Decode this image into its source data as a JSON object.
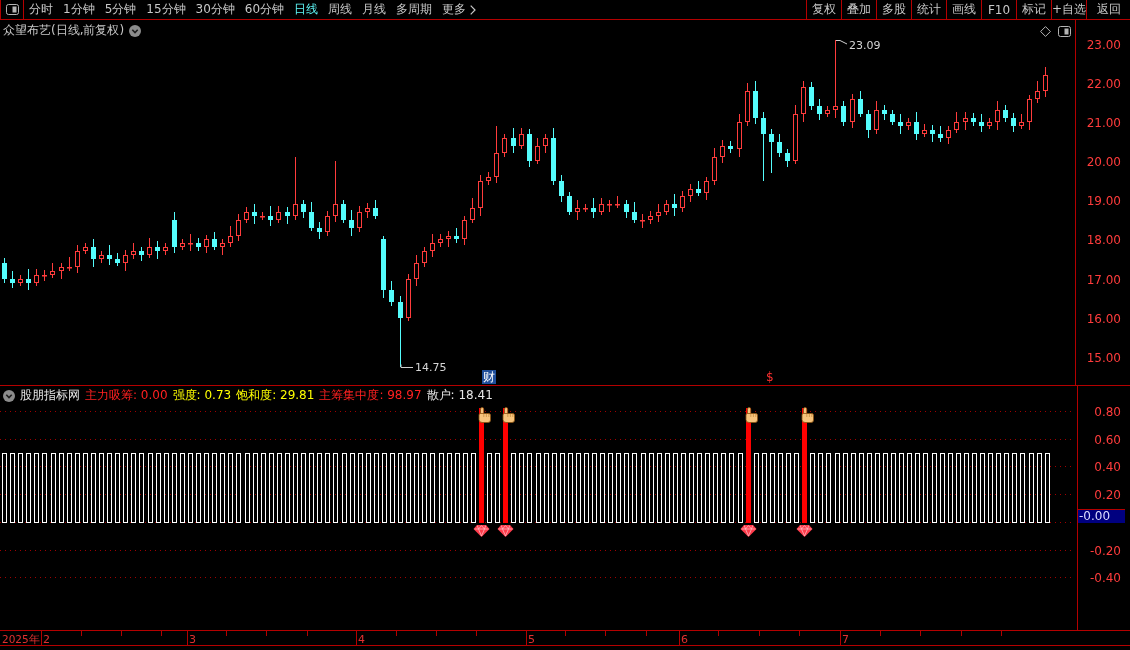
{
  "toolbar": {
    "periods": [
      {
        "label": "分时",
        "selected": false
      },
      {
        "label": "1分钟",
        "selected": false
      },
      {
        "label": "5分钟",
        "selected": false
      },
      {
        "label": "15分钟",
        "selected": false
      },
      {
        "label": "30分钟",
        "selected": false
      },
      {
        "label": "60分钟",
        "selected": false
      },
      {
        "label": "日线",
        "selected": true
      },
      {
        "label": "周线",
        "selected": false
      },
      {
        "label": "月线",
        "selected": false
      },
      {
        "label": "多周期",
        "selected": false
      }
    ],
    "more": {
      "label": "更多"
    },
    "buttons": [
      "复权",
      "叠加",
      "多股",
      "统计",
      "画线",
      "F10",
      "标记",
      "+自选",
      "返回"
    ]
  },
  "price_chart": {
    "title": "众望布艺(日线,前复权)",
    "high_label": "23.09",
    "low_label": "14.75",
    "event_marks": [
      {
        "kind": "finance",
        "text": "财"
      },
      {
        "kind": "dollar",
        "text": "$"
      }
    ],
    "chart_data": {
      "type": "candlestick",
      "ylim": [
        14.28,
        23.61
      ],
      "yticks": [
        {
          "value": 23,
          "label": "23.00"
        },
        {
          "value": 22,
          "label": "22.00"
        },
        {
          "value": 21,
          "label": "21.00"
        },
        {
          "value": 20,
          "label": "20.00"
        },
        {
          "value": 19,
          "label": "19.00"
        },
        {
          "value": 18,
          "label": "18.00"
        },
        {
          "value": 17,
          "label": "17.00"
        },
        {
          "value": 16,
          "label": "16.00"
        },
        {
          "value": 15,
          "label": "15.00"
        }
      ],
      "categories": [
        null,
        null,
        null,
        null,
        null,
        null,
        null,
        null,
        null,
        null,
        null,
        null,
        null,
        null,
        null,
        null,
        null,
        null,
        null,
        null,
        null,
        null,
        null,
        null,
        null,
        null,
        null,
        null,
        null,
        null,
        null,
        null,
        null,
        null,
        null,
        null,
        null,
        null,
        null,
        null,
        null,
        null,
        null,
        null,
        null,
        null,
        null,
        null,
        null,
        null,
        null,
        null,
        null,
        null,
        null,
        null,
        null,
        null,
        null,
        null,
        null,
        null,
        null,
        null,
        null,
        null,
        null,
        null,
        null,
        null,
        null,
        null,
        null,
        null,
        null,
        null,
        null,
        null,
        null,
        null,
        null,
        null,
        null,
        null,
        null,
        null,
        null,
        null,
        null,
        null,
        null,
        null,
        null,
        null,
        null,
        null,
        null,
        null,
        null,
        null,
        null,
        null,
        null,
        null,
        null,
        null,
        null,
        null,
        null,
        null,
        null,
        null,
        null,
        null,
        null,
        null,
        null,
        null,
        null,
        null,
        null,
        null,
        null,
        null,
        null,
        null,
        null,
        null,
        null,
        null,
        null,
        null,
        null,
        null,
        null,
        null,
        null,
        null,
        null,
        null
      ],
      "ohlc": [
        [
          17.4,
          17.52,
          16.9,
          17.0
        ],
        [
          17.0,
          17.2,
          16.75,
          16.9
        ],
        [
          16.9,
          17.1,
          16.82,
          17.0
        ],
        [
          17.0,
          17.25,
          16.7,
          16.9
        ],
        [
          16.9,
          17.25,
          16.8,
          17.1
        ],
        [
          17.1,
          17.22,
          16.95,
          17.1
        ],
        [
          17.1,
          17.4,
          17.02,
          17.2
        ],
        [
          17.2,
          17.4,
          17.0,
          17.3
        ],
        [
          17.3,
          17.55,
          17.2,
          17.3
        ],
        [
          17.3,
          17.85,
          17.15,
          17.7
        ],
        [
          17.7,
          17.92,
          17.62,
          17.8
        ],
        [
          17.8,
          18.0,
          17.3,
          17.5
        ],
        [
          17.5,
          17.7,
          17.4,
          17.6
        ],
        [
          17.6,
          17.85,
          17.35,
          17.5
        ],
        [
          17.5,
          17.65,
          17.32,
          17.4
        ],
        [
          17.4,
          17.72,
          17.2,
          17.6
        ],
        [
          17.6,
          17.9,
          17.5,
          17.7
        ],
        [
          17.7,
          17.8,
          17.45,
          17.6
        ],
        [
          17.6,
          18.05,
          17.52,
          17.8
        ],
        [
          17.8,
          17.95,
          17.5,
          17.7
        ],
        [
          17.7,
          17.92,
          17.6,
          17.8
        ],
        [
          18.5,
          18.7,
          17.65,
          17.8
        ],
        [
          17.8,
          18.0,
          17.72,
          17.9
        ],
        [
          17.9,
          18.15,
          17.7,
          17.9
        ],
        [
          17.9,
          18.05,
          17.7,
          17.8
        ],
        [
          17.8,
          18.12,
          17.65,
          18.0
        ],
        [
          18.0,
          18.2,
          17.72,
          17.8
        ],
        [
          17.8,
          18.0,
          17.6,
          17.9
        ],
        [
          17.9,
          18.35,
          17.8,
          18.1
        ],
        [
          18.1,
          18.65,
          17.95,
          18.5
        ],
        [
          18.5,
          18.82,
          18.42,
          18.7
        ],
        [
          18.7,
          18.9,
          18.4,
          18.6
        ],
        [
          18.6,
          18.7,
          18.5,
          18.6
        ],
        [
          18.6,
          18.85,
          18.35,
          18.5
        ],
        [
          18.5,
          18.85,
          18.42,
          18.7
        ],
        [
          18.7,
          18.82,
          18.4,
          18.6
        ],
        [
          18.6,
          20.1,
          18.5,
          18.9
        ],
        [
          18.9,
          19.0,
          18.55,
          18.7
        ],
        [
          18.7,
          18.95,
          18.22,
          18.3
        ],
        [
          18.3,
          18.45,
          18.0,
          18.2
        ],
        [
          18.2,
          18.72,
          18.1,
          18.6
        ],
        [
          18.6,
          20.0,
          18.45,
          18.9
        ],
        [
          18.9,
          19.0,
          18.42,
          18.5
        ],
        [
          18.5,
          18.75,
          18.1,
          18.3
        ],
        [
          18.3,
          18.85,
          18.2,
          18.7
        ],
        [
          18.7,
          18.92,
          18.55,
          18.8
        ],
        [
          18.8,
          19.0,
          18.52,
          18.6
        ],
        [
          18.0,
          18.1,
          16.5,
          16.7
        ],
        [
          16.7,
          16.95,
          16.3,
          16.4
        ],
        [
          16.4,
          16.55,
          14.75,
          16.0
        ],
        [
          16.0,
          17.12,
          15.92,
          17.0
        ],
        [
          17.0,
          17.6,
          16.8,
          17.4
        ],
        [
          17.4,
          17.8,
          17.3,
          17.7
        ],
        [
          17.7,
          18.15,
          17.55,
          17.9
        ],
        [
          17.9,
          18.15,
          17.82,
          18.0
        ],
        [
          18.0,
          18.22,
          17.8,
          18.1
        ],
        [
          18.1,
          18.3,
          17.9,
          18.0
        ],
        [
          18.0,
          18.6,
          17.85,
          18.5
        ],
        [
          18.5,
          19.05,
          18.42,
          18.8
        ],
        [
          18.8,
          19.65,
          18.6,
          19.5
        ],
        [
          19.5,
          19.72,
          19.4,
          19.6
        ],
        [
          19.6,
          20.9,
          19.45,
          20.2
        ],
        [
          20.2,
          20.7,
          20.12,
          20.6
        ],
        [
          20.6,
          20.85,
          20.2,
          20.4
        ],
        [
          20.4,
          20.85,
          20.3,
          20.7
        ],
        [
          20.7,
          20.82,
          19.85,
          20.0
        ],
        [
          20.0,
          20.6,
          19.92,
          20.4
        ],
        [
          20.4,
          20.7,
          20.2,
          20.6
        ],
        [
          20.6,
          20.85,
          19.4,
          19.5
        ],
        [
          19.5,
          19.65,
          18.95,
          19.1
        ],
        [
          19.1,
          19.22,
          18.62,
          18.7
        ],
        [
          18.7,
          19.0,
          18.5,
          18.8
        ],
        [
          18.8,
          18.9,
          18.7,
          18.8
        ],
        [
          18.8,
          19.05,
          18.55,
          18.7
        ],
        [
          18.7,
          19.05,
          18.62,
          18.9
        ],
        [
          18.9,
          19.02,
          18.7,
          18.9
        ],
        [
          18.9,
          19.1,
          18.8,
          18.9
        ],
        [
          18.9,
          19.0,
          18.55,
          18.7
        ],
        [
          18.7,
          18.95,
          18.42,
          18.5
        ],
        [
          18.5,
          18.65,
          18.3,
          18.5
        ],
        [
          18.5,
          18.72,
          18.4,
          18.6
        ],
        [
          18.6,
          18.9,
          18.45,
          18.7
        ],
        [
          18.7,
          19.0,
          18.62,
          18.9
        ],
        [
          18.9,
          19.15,
          18.6,
          18.8
        ],
        [
          18.8,
          19.25,
          18.7,
          19.1
        ],
        [
          19.1,
          19.42,
          18.95,
          19.3
        ],
        [
          19.3,
          19.5,
          19.12,
          19.2
        ],
        [
          19.2,
          19.6,
          19.0,
          19.5
        ],
        [
          19.5,
          20.35,
          19.4,
          20.1
        ],
        [
          20.1,
          20.55,
          19.95,
          20.4
        ],
        [
          20.4,
          20.52,
          20.22,
          20.3
        ],
        [
          20.3,
          21.2,
          20.1,
          21.0
        ],
        [
          21.0,
          22.0,
          20.9,
          21.8
        ],
        [
          21.8,
          22.05,
          20.95,
          21.1
        ],
        [
          21.1,
          21.25,
          19.5,
          20.7
        ],
        [
          20.7,
          20.82,
          19.7,
          20.5
        ],
        [
          20.5,
          20.7,
          20.1,
          20.2
        ],
        [
          20.2,
          20.3,
          19.85,
          20.0
        ],
        [
          20.0,
          21.45,
          19.92,
          21.2
        ],
        [
          21.2,
          22.05,
          21.0,
          21.9
        ],
        [
          21.9,
          22.02,
          21.3,
          21.4
        ],
        [
          21.4,
          21.6,
          21.05,
          21.2
        ],
        [
          21.2,
          21.4,
          21.12,
          21.3
        ],
        [
          21.3,
          23.09,
          21.1,
          21.4
        ],
        [
          21.4,
          21.55,
          20.9,
          21.0
        ],
        [
          21.0,
          21.72,
          20.85,
          21.6
        ],
        [
          21.6,
          21.8,
          21.12,
          21.2
        ],
        [
          21.2,
          21.3,
          20.6,
          20.8
        ],
        [
          20.8,
          21.55,
          20.7,
          21.3
        ],
        [
          21.3,
          21.45,
          21.05,
          21.2
        ],
        [
          21.2,
          21.32,
          20.92,
          21.0
        ],
        [
          21.0,
          21.2,
          20.7,
          20.9
        ],
        [
          20.9,
          21.1,
          20.8,
          21.0
        ],
        [
          21.0,
          21.25,
          20.55,
          20.7
        ],
        [
          20.7,
          20.95,
          20.62,
          20.8
        ],
        [
          20.8,
          20.92,
          20.5,
          20.7
        ],
        [
          20.7,
          20.9,
          20.5,
          20.6
        ],
        [
          20.6,
          20.9,
          20.45,
          20.8
        ],
        [
          20.8,
          21.25,
          20.72,
          21.0
        ],
        [
          21.0,
          21.25,
          20.8,
          21.1
        ],
        [
          21.1,
          21.22,
          20.9,
          21.0
        ],
        [
          21.0,
          21.2,
          20.75,
          20.9
        ],
        [
          20.9,
          21.1,
          20.82,
          21.0
        ],
        [
          21.0,
          21.55,
          20.8,
          21.3
        ],
        [
          21.3,
          21.45,
          21.0,
          21.1
        ],
        [
          21.1,
          21.22,
          20.75,
          20.9
        ],
        [
          20.9,
          21.2,
          20.82,
          21.0
        ],
        [
          21.0,
          21.7,
          20.8,
          21.6
        ],
        [
          21.6,
          22.05,
          21.5,
          21.8
        ],
        [
          21.8,
          22.4,
          21.65,
          22.2
        ],
        null,
        null,
        null,
        null,
        null,
        null,
        null,
        null,
        null,
        null
      ]
    }
  },
  "indicator": {
    "name": "股朋指标网",
    "readings": [
      {
        "text": "主力吸筹: 0.00",
        "color": "#ff2020"
      },
      {
        "text": "强度: 0.73",
        "color": "#ffff00"
      },
      {
        "text": "饱和度: 29.81",
        "color": "#ffff00"
      },
      {
        "text": "主筹集中度: 98.97",
        "color": "#ff2020"
      },
      {
        "text": "散户: 18.41",
        "color": "#e6e6e6"
      }
    ],
    "current_value": "-0.00",
    "chart_data": {
      "type": "bar",
      "grid": true,
      "ylim": [
        -0.78,
        0.98
      ],
      "yticks": [
        {
          "value": 0.8,
          "label": "0.80"
        },
        {
          "value": 0.6,
          "label": "0.60"
        },
        {
          "value": 0.4,
          "label": "0.40"
        },
        {
          "value": 0.2,
          "label": "0.20"
        },
        {
          "value": -0.2,
          "label": "-0.20"
        },
        {
          "value": -0.4,
          "label": "-0.40"
        }
      ],
      "series": [
        {
          "color": "#ffffff",
          "values": [
            0.5,
            0.5,
            0.5,
            0.5,
            0.5,
            0.5,
            0.5,
            0.5,
            0.5,
            0.5,
            0.5,
            0.5,
            0.5,
            0.5,
            0.5,
            0.5,
            0.5,
            0.5,
            0.5,
            0.5,
            0.5,
            0.5,
            0.5,
            0.5,
            0.5,
            0.5,
            0.5,
            0.5,
            0.5,
            0.5,
            0.5,
            0.5,
            0.5,
            0.5,
            0.5,
            0.5,
            0.5,
            0.5,
            0.5,
            0.5,
            0.5,
            0.5,
            0.5,
            0.5,
            0.5,
            0.5,
            0.5,
            0.5,
            0.5,
            0.5,
            0.5,
            0.5,
            0.5,
            0.5,
            0.5,
            0.5,
            0.5,
            0.5,
            0.5,
            null,
            0.5,
            0.5,
            null,
            0.5,
            0.5,
            0.5,
            0.5,
            0.5,
            0.5,
            0.5,
            0.5,
            0.5,
            0.5,
            0.5,
            0.5,
            0.5,
            0.5,
            0.5,
            0.5,
            0.5,
            0.5,
            0.5,
            0.5,
            0.5,
            0.5,
            0.5,
            0.5,
            0.5,
            0.5,
            0.5,
            0.5,
            0.5,
            null,
            0.5,
            0.5,
            0.5,
            0.5,
            0.5,
            0.5,
            null,
            0.5,
            0.5,
            0.5,
            0.5,
            0.5,
            0.5,
            0.5,
            0.5,
            0.5,
            0.5,
            0.5,
            0.5,
            0.5,
            0.5,
            0.5,
            0.5,
            0.5,
            0.5,
            0.5,
            0.5,
            0.5,
            0.5,
            0.5,
            0.5,
            0.5,
            0.5,
            0.5,
            0.5,
            0.5,
            0.5,
            null,
            null,
            null
          ]
        },
        {
          "color": "#ff0000",
          "values": [
            null,
            null,
            null,
            null,
            null,
            null,
            null,
            null,
            null,
            null,
            null,
            null,
            null,
            null,
            null,
            null,
            null,
            null,
            null,
            null,
            null,
            null,
            null,
            null,
            null,
            null,
            null,
            null,
            null,
            null,
            null,
            null,
            null,
            null,
            null,
            null,
            null,
            null,
            null,
            null,
            null,
            null,
            null,
            null,
            null,
            null,
            null,
            null,
            null,
            null,
            null,
            null,
            null,
            null,
            null,
            null,
            null,
            null,
            null,
            0.82,
            null,
            null,
            0.82,
            null,
            null,
            null,
            null,
            null,
            null,
            null,
            null,
            null,
            null,
            null,
            null,
            null,
            null,
            null,
            null,
            null,
            null,
            null,
            null,
            null,
            null,
            null,
            null,
            null,
            null,
            null,
            null,
            null,
            0.82,
            null,
            null,
            null,
            null,
            null,
            null,
            0.82,
            null,
            null,
            null,
            null,
            null,
            null,
            null,
            null,
            null,
            null,
            null,
            null,
            null,
            null,
            null,
            null,
            null,
            null,
            null,
            null,
            null,
            null,
            null,
            null,
            null,
            null,
            null,
            null,
            null,
            null,
            null,
            null,
            null
          ]
        }
      ]
    }
  },
  "time_axis": {
    "year_label": "2025年",
    "months": [
      "2",
      "3",
      "4",
      "5",
      "6",
      "7"
    ]
  }
}
